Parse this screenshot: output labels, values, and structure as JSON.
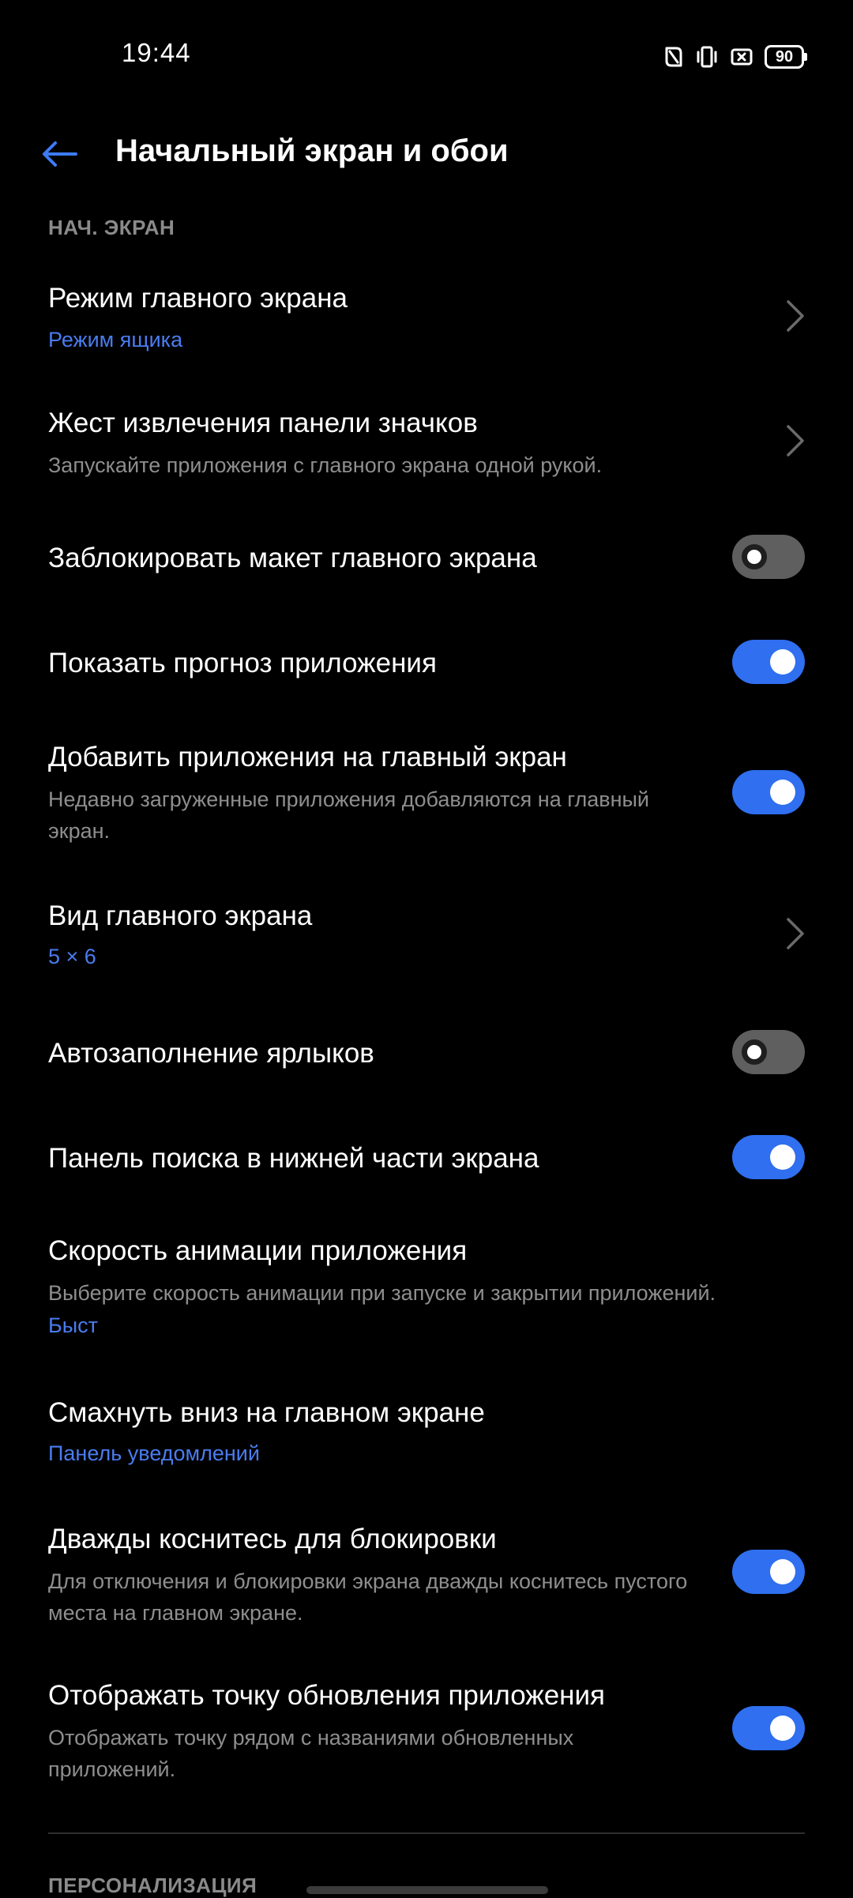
{
  "status_bar": {
    "time": "19:44",
    "battery": "90",
    "icons": [
      "nfc-icon",
      "vibrate-icon",
      "screen-record-icon",
      "battery-icon"
    ]
  },
  "header": {
    "back_icon": "arrow-left-icon",
    "title": "Начальный экран и обои"
  },
  "section_home": "НАЧ. ЭКРАН",
  "rows": [
    {
      "title": "Режим главного экрана",
      "value": "Режим ящика",
      "control": "chevron"
    },
    {
      "title": "Жест извлечения панели значков",
      "subtitle": "Запускайте приложения с главного экрана одной рукой.",
      "control": "chevron"
    },
    {
      "title": "Заблокировать макет главного экрана",
      "control": "toggle",
      "checked": false
    },
    {
      "title": "Показать прогноз приложения",
      "control": "toggle",
      "checked": true
    },
    {
      "title": "Добавить приложения на главный экран",
      "subtitle": "Недавно загруженные приложения добавляются на главный экран.",
      "control": "toggle",
      "checked": true
    },
    {
      "title": "Вид главного экрана",
      "value": "5 × 6",
      "control": "chevron"
    },
    {
      "title": "Автозаполнение ярлыков",
      "control": "toggle",
      "checked": false
    },
    {
      "title": "Панель поиска в нижней части экрана",
      "control": "toggle",
      "checked": true
    },
    {
      "title": "Скорость анимации приложения",
      "subtitle": "Выберите скорость анимации при запуске и закрытии приложений.",
      "value": "Быст"
    },
    {
      "title": "Смахнуть вниз на главном экране",
      "value": "Панель уведомлений"
    },
    {
      "title": "Дважды коснитесь для блокировки",
      "subtitle": "Для отключения и блокировки экрана дважды коснитесь пустого места на главном экране.",
      "control": "toggle",
      "checked": true
    },
    {
      "title": "Отображать точку обновления приложения",
      "subtitle": "Отображать точку рядом с названиями обновленных приложений.",
      "control": "toggle",
      "checked": true
    }
  ],
  "section_personalization": "ПЕРСОНАЛИЗАЦИЯ",
  "colors": {
    "accent": "#2f6ff0",
    "accent_text": "#4a7cf0",
    "background": "#000000",
    "toggle_off": "#5f5f5f",
    "secondary_text": "#8e8e8e"
  }
}
